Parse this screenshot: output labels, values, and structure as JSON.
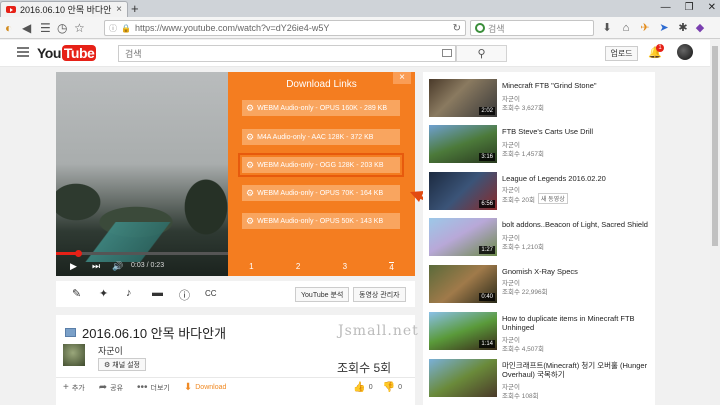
{
  "browser": {
    "tab_title": "2016.06.10 안목 바다안...",
    "tab_close": "×",
    "new_tab": "+",
    "url": "https://www.youtube.com/watch?v=dY26ie4-w5Y",
    "search_placeholder": "검색",
    "window_controls": [
      "—",
      "❐",
      "✕"
    ]
  },
  "yt_header": {
    "logo_you": "You",
    "logo_tube": "Tube",
    "search_placeholder": "검색",
    "upload_label": "업로드",
    "notification_count": "1"
  },
  "download_panel": {
    "title": "Download Links",
    "close": "×",
    "items": [
      "WEBM Audio-only - OPUS 160K - 289 KB",
      "M4A Audio-only - AAC 128K - 372 KB",
      "WEBM Audio-only - OGG 128K - 203 KB",
      "WEBM Audio-only - OPUS 70K - 164 KB",
      "WEBM Audio-only - OPUS 50K - 143 KB"
    ],
    "pages": [
      "1",
      "2",
      "3",
      "4"
    ],
    "active_page": 3,
    "highlighted_item": 2
  },
  "player": {
    "time": "0:03 / 0:23",
    "progress": 0.13
  },
  "tools": {
    "youtube_analytics": "YouTube 분석",
    "video_manager": "동영상 관리자"
  },
  "video_info": {
    "title": "2016.06.10 안목 바다안개",
    "watermark": "Jsmall.net",
    "channel_name": "자군이",
    "channel_settings": "채널 설정",
    "views": "조회수 5회",
    "actions": {
      "add": "추가",
      "share": "공유",
      "more": "더보기",
      "download": "Download",
      "likes": "0",
      "dislikes": "0"
    }
  },
  "sidebar": {
    "items": [
      {
        "title": "Minecraft FTB \"Grind Stone\"",
        "channel": "자군이",
        "views": "조회수 3,627회",
        "duration": "2:02",
        "badge": ""
      },
      {
        "title": "FTB Steve's Carts Use Drill",
        "channel": "자군이",
        "views": "조회수 1,457회",
        "duration": "3:16",
        "badge": ""
      },
      {
        "title": "League of Legends 2016.02.20",
        "channel": "자군이",
        "views": "조회수 20회",
        "duration": "6:56",
        "badge": "새 동영상"
      },
      {
        "title": "bolt addons..Beacon of Light, Sacred Shield",
        "channel": "자군이",
        "views": "조회수 1,210회",
        "duration": "1:27",
        "badge": ""
      },
      {
        "title": "Gnomish X-Ray Specs",
        "channel": "자군이",
        "views": "조회수 22,996회",
        "duration": "0:40",
        "badge": ""
      },
      {
        "title": "How to duplicate items in Minecraft FTB Unhinged",
        "channel": "자군이",
        "views": "조회수 4,507회",
        "duration": "1:14",
        "badge": ""
      },
      {
        "title": "마인크래프트(Minecraft) 청기 오버홀 (Hunger Overhaul) 국복하기",
        "channel": "자군이",
        "views": "조회수 108회",
        "duration": "",
        "badge": ""
      }
    ]
  }
}
